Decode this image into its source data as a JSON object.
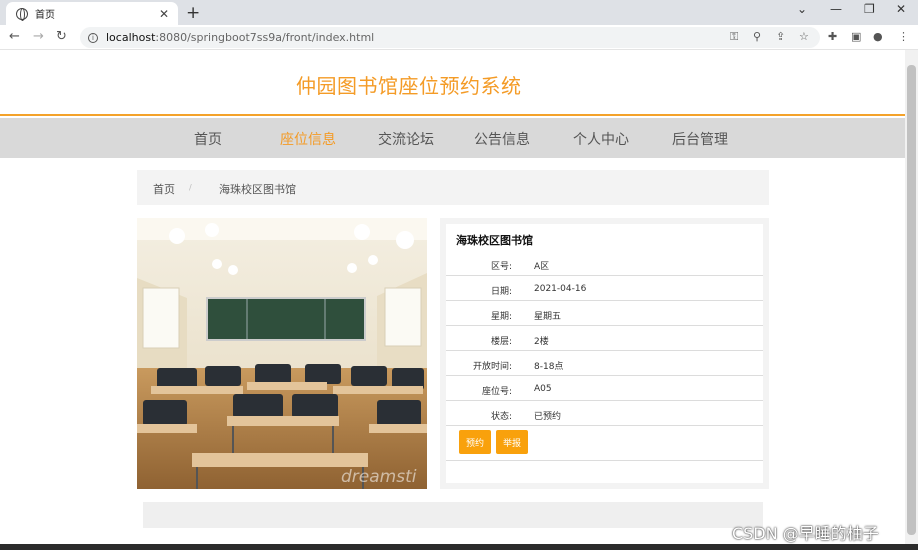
{
  "browser": {
    "tab_title": "首页",
    "url_host": "localhost",
    "url_rest": ":8080/springboot7ss9a/front/index.html"
  },
  "site": {
    "title": "仲园图书馆座位预约系统",
    "nav": [
      "首页",
      "座位信息",
      "交流论坛",
      "公告信息",
      "个人中心",
      "后台管理"
    ],
    "active_nav": "座位信息"
  },
  "breadcrumb": {
    "home": "首页",
    "sep": "/",
    "current": "海珠校区图书馆"
  },
  "detail": {
    "name": "海珠校区图书馆",
    "fields": [
      {
        "label": "区号:",
        "value": "A区"
      },
      {
        "label": "日期:",
        "value": "2021-04-16"
      },
      {
        "label": "星期:",
        "value": "星期五"
      },
      {
        "label": "楼层:",
        "value": "2楼"
      },
      {
        "label": "开放时间:",
        "value": "8-18点"
      },
      {
        "label": "座位号:",
        "value": "A05"
      },
      {
        "label": "状态:",
        "value": "已预约"
      }
    ],
    "buttons": {
      "reserve": "预约",
      "report": "举报"
    }
  },
  "watermark": "CSDN @早睡的柚子",
  "colors": {
    "accent": "#f49b26",
    "button": "#f9a10c"
  }
}
